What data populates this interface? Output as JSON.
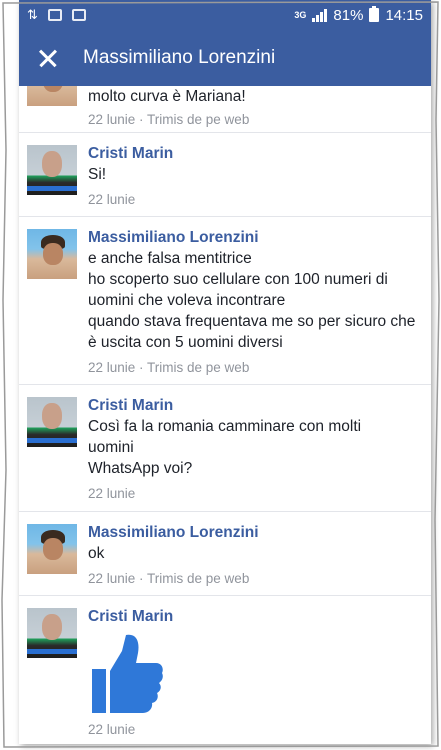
{
  "statusbar": {
    "network": "3G",
    "battery": "81%",
    "time": "14:15"
  },
  "header": {
    "title": "Massimiliano Lorenzini",
    "close_icon": "close-icon"
  },
  "comments": [
    {
      "author": "",
      "lines": [
        "molto curva è Mariana!"
      ],
      "meta": "22 lunie · Trimis de pe web"
    },
    {
      "author": "Cristi Marin",
      "lines": [
        "Si!"
      ],
      "meta": "22 lunie"
    },
    {
      "author": "Massimiliano Lorenzini",
      "lines": [
        "e anche falsa mentitrice",
        "ho scoperto suo cellulare con 100 numeri di uomini che voleva incontrare",
        "quando stava frequentava me so per sicuro che è uscita con 5 uomini diversi"
      ],
      "meta": "22 lunie · Trimis de pe web"
    },
    {
      "author": "Cristi Marin",
      "lines": [
        "Così fa la romania camminare con molti uomini",
        "WhatsApp voi?"
      ],
      "meta": "22 lunie"
    },
    {
      "author": "Massimiliano Lorenzini",
      "lines": [
        "ok"
      ],
      "meta": "22 lunie · Trimis de pe web"
    },
    {
      "author": "Cristi Marin",
      "lines": [],
      "sticker": "like-thumb-icon",
      "meta": "22 lunie"
    }
  ],
  "colors": {
    "brand": "#3b5da0",
    "author": "#3b5da0",
    "meta": "#90949c",
    "like": "#2f78d8"
  }
}
